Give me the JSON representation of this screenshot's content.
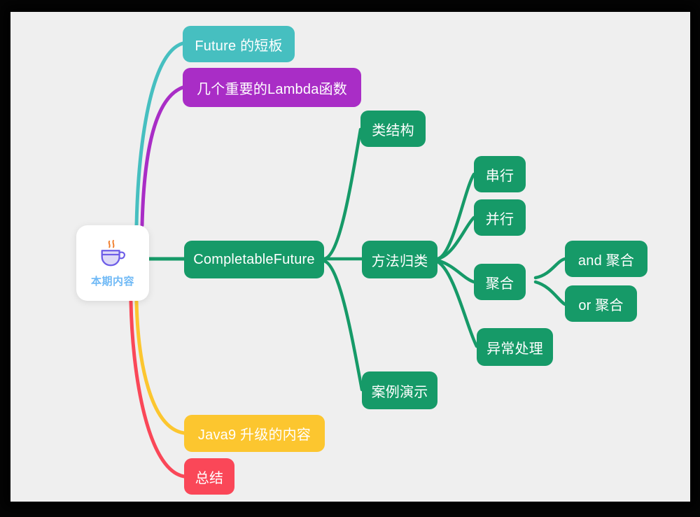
{
  "canvas": {
    "background_color": "#efefef",
    "frame_color": "#000000"
  },
  "root": {
    "label": "本期内容",
    "icon": "coffee-cup-icon",
    "label_color": "#6fb9f6",
    "card_color": "#ffffff",
    "icon_outline_color": "#6c5ce7",
    "icon_fill_color": "#ddd9f7",
    "icon_steam_color": "#f07c2a"
  },
  "palette": {
    "teal": "#46bfc0",
    "purple": "#a92dc6",
    "green": "#169a68",
    "yellow": "#fcc62f",
    "red": "#fa4758"
  },
  "nodes": {
    "future_weakness": {
      "label": "Future 的短板",
      "color": "#46bfc0"
    },
    "lambda_functions": {
      "label": "几个重要的Lambda函数",
      "color": "#a92dc6"
    },
    "completable_future": {
      "label": "CompletableFuture",
      "color": "#169a68"
    },
    "class_structure": {
      "label": "类结构",
      "color": "#169a68"
    },
    "method_categories": {
      "label": "方法归类",
      "color": "#169a68"
    },
    "case_demo": {
      "label": "案例演示",
      "color": "#169a68"
    },
    "serial": {
      "label": "串行",
      "color": "#169a68"
    },
    "parallel": {
      "label": "并行",
      "color": "#169a68"
    },
    "aggregate": {
      "label": "聚合",
      "color": "#169a68"
    },
    "and_aggregate": {
      "label": "and 聚合",
      "color": "#169a68"
    },
    "or_aggregate": {
      "label": "or 聚合",
      "color": "#169a68"
    },
    "exception_handling": {
      "label": "异常处理",
      "color": "#169a68"
    },
    "java9_upgrade": {
      "label": "Java9 升级的内容",
      "color": "#fcc62f"
    },
    "summary": {
      "label": "总结",
      "color": "#fa4758"
    }
  }
}
